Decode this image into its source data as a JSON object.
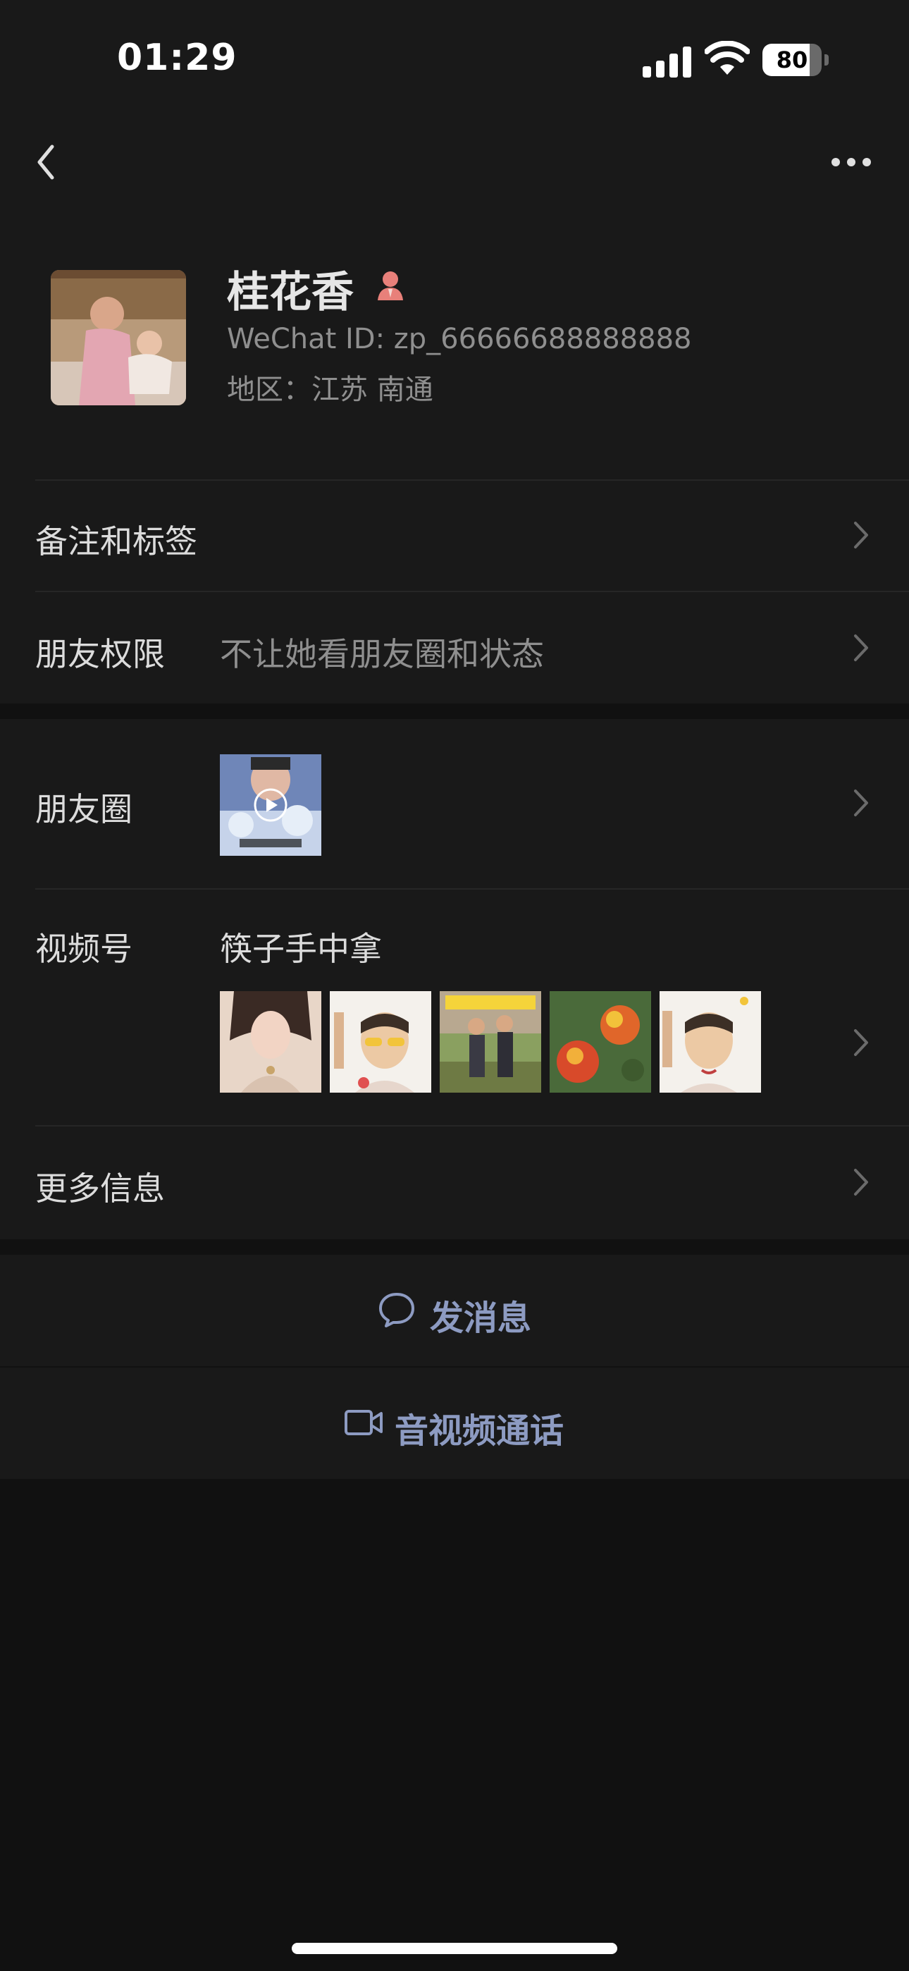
{
  "status_bar": {
    "time": "01:29",
    "battery_level": "80"
  },
  "nav": {
    "back_icon": "chevron-left-icon",
    "more_icon": "ellipsis-icon"
  },
  "profile": {
    "name": "桂花香",
    "gender_icon": "female-icon",
    "wechat_id": "WeChat ID: zp_66666688888888",
    "region": "地区：江苏 南通"
  },
  "rows": {
    "remarks_label": "备注和标签",
    "permissions_label": "朋友权限",
    "permissions_value": "不让她看朋友圈和状态",
    "moments_label": "朋友圈",
    "channels_label": "视频号",
    "channels_name": "筷子手中拿",
    "more_info_label": "更多信息"
  },
  "actions": {
    "message_label": "发消息",
    "call_label": "音视频通话"
  },
  "colors": {
    "background": "#111111",
    "surface": "#191919",
    "action_text": "#8d9bc2",
    "female_icon": "#e8807a"
  }
}
